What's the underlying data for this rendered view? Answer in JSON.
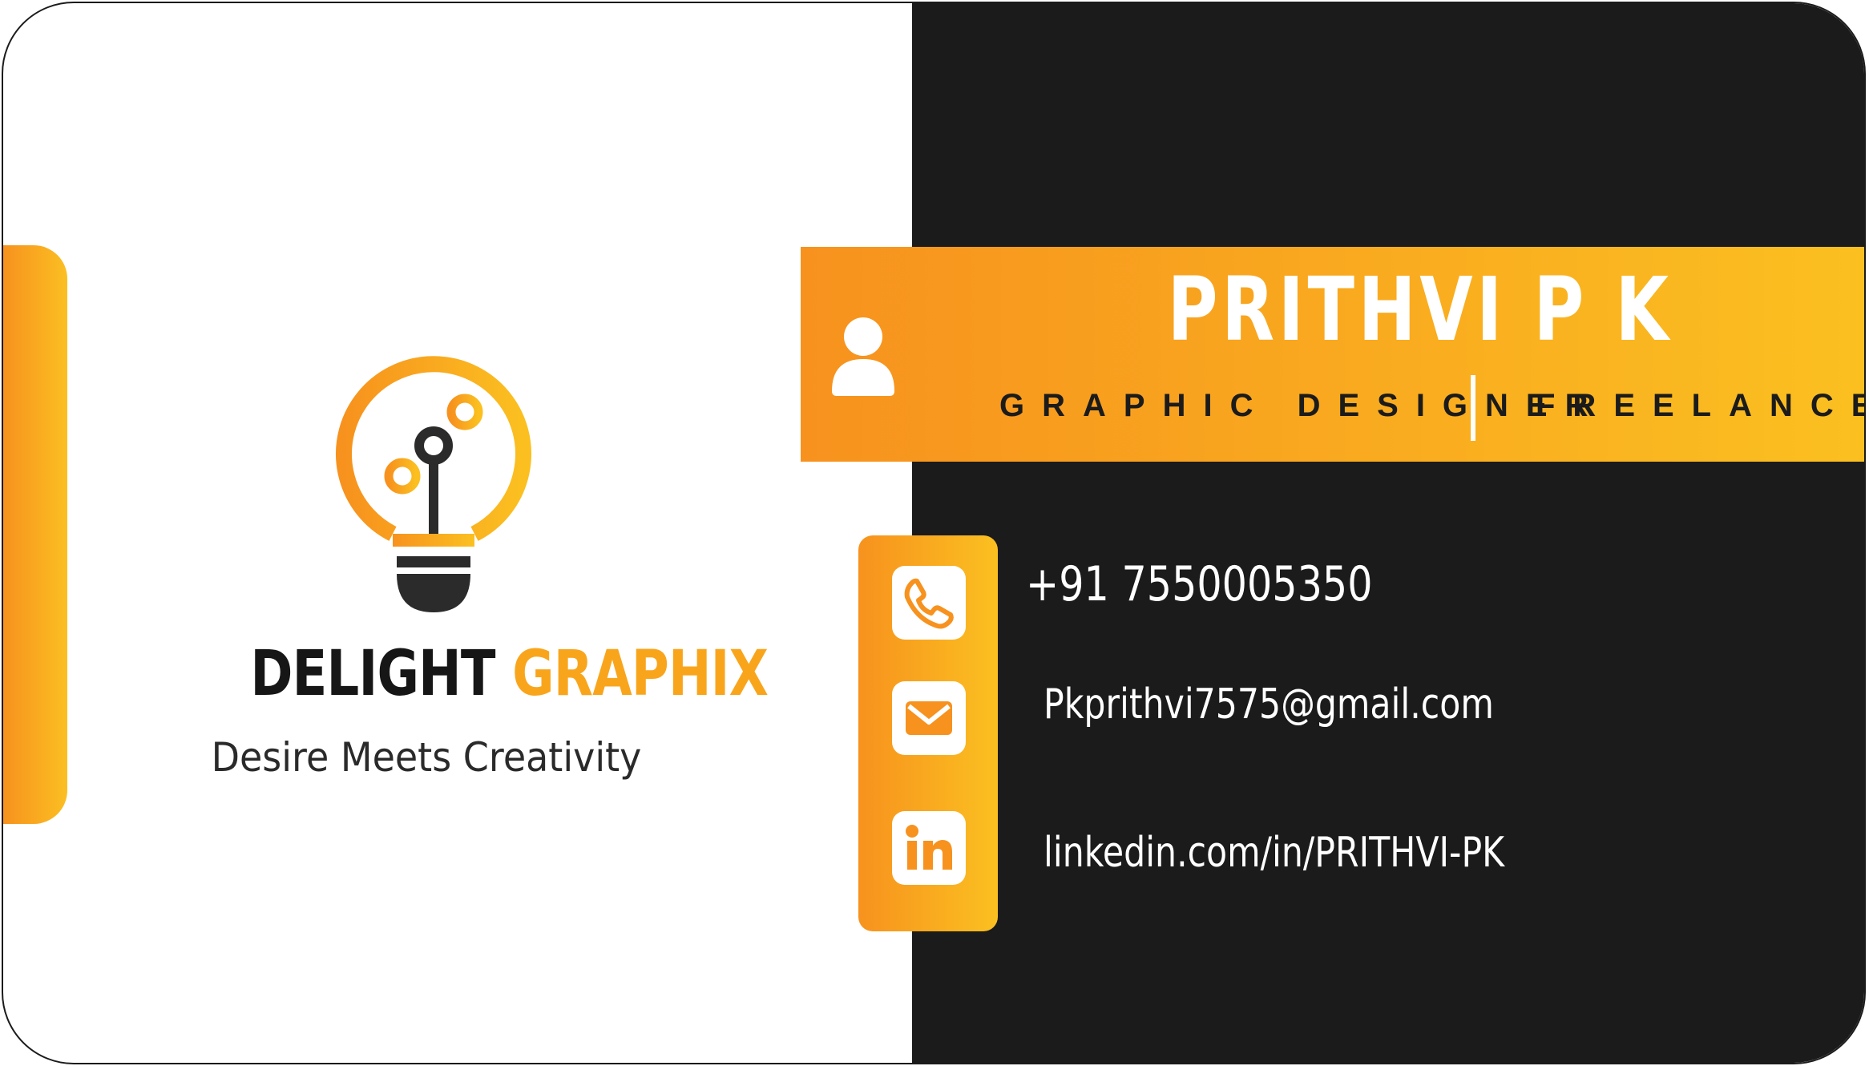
{
  "card": {
    "colors": {
      "accent_start": "#f7921e",
      "accent_end": "#fbc020",
      "dark": "#1b1b1b",
      "light": "#ffffff"
    }
  },
  "logo": {
    "icon": "lightbulb-circuit-icon",
    "brand_word1": "DELIGHT",
    "brand_word2": "GRAPHIX",
    "tagline": "Desire Meets Creativity"
  },
  "profile": {
    "icon": "person-icon",
    "name": "PRITHVI  P K",
    "role_primary": "GRAPHIC DESIGNER",
    "role_secondary": "FREELANCER"
  },
  "contacts": [
    {
      "icon": "phone-icon",
      "value": "+91 7550005350"
    },
    {
      "icon": "mail-icon",
      "value": "Pkprithvi7575@gmail.com"
    },
    {
      "icon": "linkedin-icon",
      "value": "linkedin.com/in/PRITHVI-PK"
    }
  ]
}
